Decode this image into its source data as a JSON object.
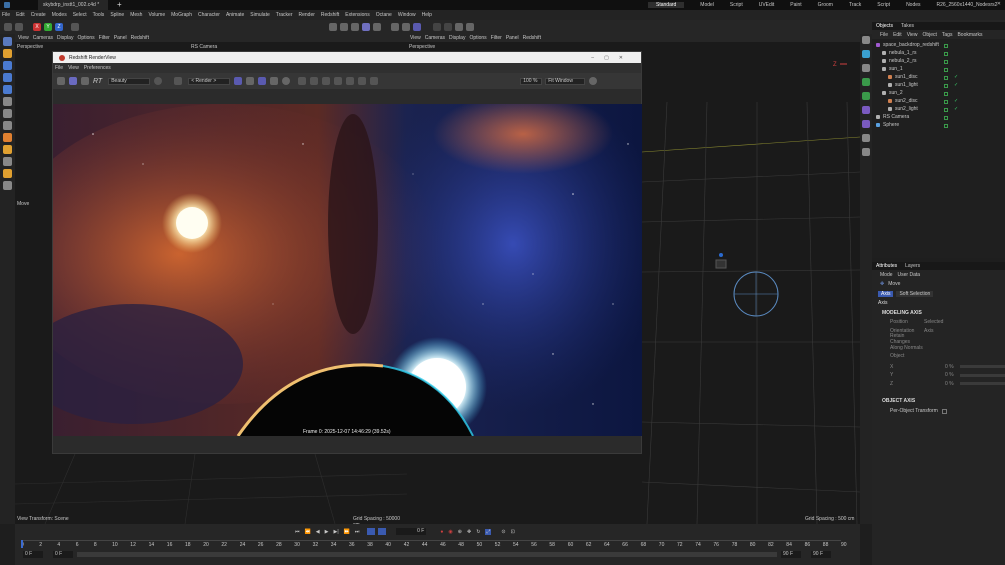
{
  "window": {
    "tab_title": "skybdrp_instt1_002.c4d *",
    "layouts": [
      "Standard",
      "Model",
      "Script",
      "UVEdit",
      "Paint",
      "Groom",
      "Track",
      "Script",
      "Nodes",
      "R26_2560x1440_Nodesrs2",
      "R26_2560x1440"
    ]
  },
  "menu": [
    "File",
    "Edit",
    "Create",
    "Modes",
    "Select",
    "Tools",
    "Spline",
    "Mesh",
    "Volume",
    "MoGraph",
    "Character",
    "Animate",
    "Simulate",
    "Tracker",
    "Render",
    "Redshift",
    "Extensions",
    "Octane",
    "Window",
    "Help"
  ],
  "axis_buttons": [
    "X",
    "Y",
    "Z"
  ],
  "viewport_left": {
    "menu": [
      "View",
      "Cameras",
      "Display",
      "Options",
      "Filter",
      "Panel",
      "Redshift"
    ],
    "label": "Perspective",
    "camera": "RS Camera",
    "footer_left": "View Transform: Scene",
    "footer_right": "Grid Spacing : 50000 cm"
  },
  "viewport_right": {
    "menu": [
      "View",
      "Cameras",
      "Display",
      "Options",
      "Filter",
      "Panel",
      "Redshift"
    ],
    "label": "Perspective",
    "footer_right": "Grid Spacing : 500 cm"
  },
  "move_label": "Move",
  "render_view": {
    "title": "Redshift RenderView",
    "menu": [
      "File",
      "View",
      "Preferences"
    ],
    "aov": "Beauty",
    "render_mode": "< Render >",
    "zoom": "100 %",
    "fit": "Fit Window",
    "rt_label": "RT",
    "status": "Frame 0:  2025-12-07  14:46:29  (39.52s)"
  },
  "objects": {
    "tabs": [
      "Objects",
      "Takes"
    ],
    "menu": [
      "File",
      "Edit",
      "View",
      "Object",
      "Tags",
      "Bookmarks"
    ],
    "items": [
      {
        "name": "space_backdrop_redshift",
        "indent": 0,
        "color": "#a05ad0"
      },
      {
        "name": "nebula_1_rs",
        "indent": 1,
        "color": "#b0b0b0"
      },
      {
        "name": "nebula_2_rs",
        "indent": 1,
        "color": "#b0b0b0"
      },
      {
        "name": "sun_1",
        "indent": 1,
        "color": "#b0b0b0"
      },
      {
        "name": "sun1_disc",
        "indent": 2,
        "color": "#d08050"
      },
      {
        "name": "sun1_light",
        "indent": 2,
        "color": "#b0b0b0"
      },
      {
        "name": "sun_2",
        "indent": 1,
        "color": "#b0b0b0"
      },
      {
        "name": "sun2_disc",
        "indent": 2,
        "color": "#d08050"
      },
      {
        "name": "sun2_light",
        "indent": 2,
        "color": "#b0b0b0"
      },
      {
        "name": "RS Camera",
        "indent": 0,
        "color": "#b0b0b0"
      },
      {
        "name": "Sphere",
        "indent": 0,
        "color": "#5aa0e0"
      }
    ]
  },
  "attributes": {
    "tabs": [
      "Attributes",
      "Layers"
    ],
    "menu": [
      "Mode",
      "User Data"
    ],
    "tool": "Move",
    "subtabs": [
      "Axis",
      "Soft Selection"
    ],
    "section_title": "Axis",
    "modeling_axis": "MODELING AXIS",
    "fields": [
      {
        "label": "Position",
        "value": "Selected"
      },
      {
        "label": "Orientation",
        "value": "Axis"
      },
      {
        "label": "Retain Changes",
        "value": ""
      },
      {
        "label": "Along Normals",
        "value": ""
      },
      {
        "label": "Object",
        "value": ""
      }
    ],
    "xyz": [
      {
        "label": "X",
        "value": "0 %"
      },
      {
        "label": "Y",
        "value": "0 %"
      },
      {
        "label": "Z",
        "value": "0 %"
      }
    ],
    "object_axis": "OBJECT AXIS",
    "per_object": "Per-Object Transform"
  },
  "timeline": {
    "current_frame": "0 F",
    "ticks": [
      "0",
      "2",
      "4",
      "6",
      "8",
      "10",
      "12",
      "14",
      "16",
      "18",
      "20",
      "22",
      "24",
      "26",
      "28",
      "30",
      "32",
      "34",
      "36",
      "38",
      "40",
      "42",
      "44",
      "46",
      "48",
      "50",
      "52",
      "54",
      "56",
      "58",
      "60",
      "62",
      "64",
      "66",
      "68",
      "70",
      "72",
      "74",
      "76",
      "78",
      "80",
      "82",
      "84",
      "86",
      "88",
      "90"
    ],
    "start": "0 F",
    "start2": "0 F",
    "end": "90 F",
    "end2": "90 F"
  }
}
